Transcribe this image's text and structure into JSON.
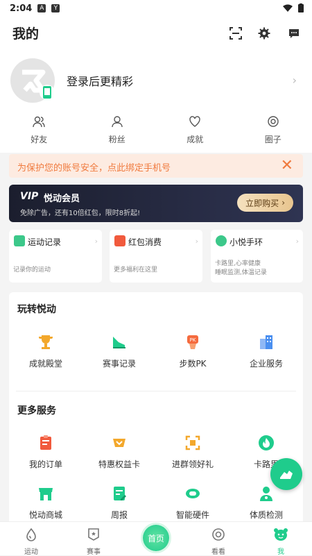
{
  "status_bar": {
    "time": "2:04"
  },
  "header": {
    "title": "我的"
  },
  "profile": {
    "login_prompt": "登录后更精彩",
    "stats": [
      {
        "label": "好友",
        "icon": "friends-icon"
      },
      {
        "label": "粉丝",
        "icon": "fans-icon"
      },
      {
        "label": "成就",
        "icon": "heart-icon"
      },
      {
        "label": "圈子",
        "icon": "circle-icon"
      }
    ]
  },
  "warning": {
    "text": "为保护您的账号安全，点此绑定手机号"
  },
  "vip": {
    "logo": "VIP",
    "name": "悦动会员",
    "desc": "免除广告，还有10倍红包，限时8折起!",
    "buy_label": "立即购买"
  },
  "cards": [
    {
      "title": "运动记录",
      "sub": "记录你的运动",
      "color": "#3cc88a"
    },
    {
      "title": "红包消费",
      "sub": "更多福利在这里",
      "color": "#f15a3d"
    },
    {
      "title": "小悦手环",
      "sub": "卡路里,心率健康\n睡眠监测,体温记录",
      "color": "#3cc88a"
    }
  ],
  "play": {
    "title": "玩转悦动",
    "items": [
      {
        "label": "成就殿堂",
        "icon": "trophy-icon",
        "color": "#f3a82c"
      },
      {
        "label": "赛事记录",
        "icon": "shoe-icon",
        "color": "#1fcc8c"
      },
      {
        "label": "步数PK",
        "icon": "pk-icon",
        "color": "#f56b3e"
      },
      {
        "label": "企业服务",
        "icon": "building-icon",
        "color": "#4a8ff0"
      }
    ]
  },
  "more": {
    "title": "更多服务",
    "items": [
      {
        "label": "我的订单",
        "icon": "order-icon",
        "color": "#f15a3d"
      },
      {
        "label": "特惠权益卡",
        "icon": "card-icon",
        "color": "#f3a82c"
      },
      {
        "label": "进群领好礼",
        "icon": "scan-icon",
        "color": "#f3a82c"
      },
      {
        "label": "卡路里",
        "icon": "fire-icon",
        "color": "#1fcc8c"
      },
      {
        "label": "悦动商城",
        "icon": "shop-icon",
        "color": "#1fcc8c"
      },
      {
        "label": "周报",
        "icon": "report-icon",
        "color": "#1fcc8c"
      },
      {
        "label": "智能硬件",
        "icon": "band-icon",
        "color": "#1fcc8c"
      },
      {
        "label": "体质检测",
        "icon": "doctor-icon",
        "color": "#1fcc8c"
      }
    ]
  },
  "tabs": [
    {
      "label": "运动",
      "icon": "run-icon"
    },
    {
      "label": "赛事",
      "icon": "badge-icon"
    },
    {
      "label": "首页",
      "icon": "home-icon"
    },
    {
      "label": "看看",
      "icon": "look-icon"
    },
    {
      "label": "我",
      "icon": "me-icon"
    }
  ],
  "colors": {
    "accent": "#1fcc8c",
    "warning": "#f07a3e"
  }
}
